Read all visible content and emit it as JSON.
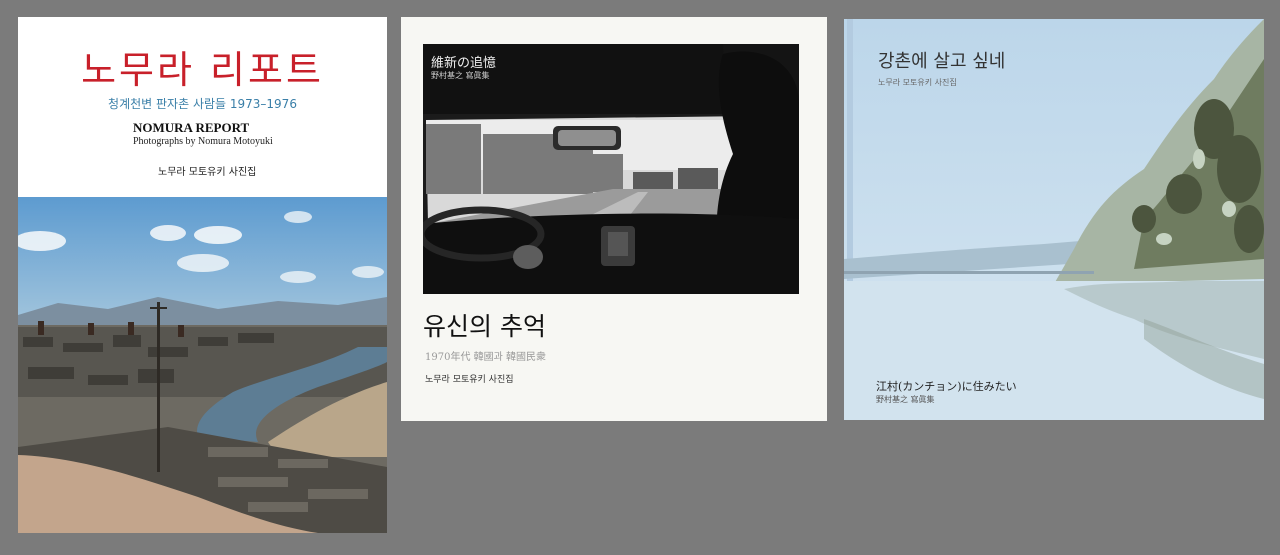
{
  "books": [
    {
      "title_ko": "노무라 리포트",
      "subtitle_ko": "청계천변 판자촌 사람들 1973–1976",
      "title_en": "NOMURA REPORT",
      "credit_en": "Photographs by Nomura Motoyuki",
      "photobook_ko": "노무라 모토유키 사진집"
    },
    {
      "photo_title": "維新の追憶",
      "photo_credit": "野村基之 寫眞集",
      "title_ko": "유신의 추억",
      "subtitle": "1970年代 韓國과 韓國民衆",
      "photobook_ko": "노무라 모토유키 사진집"
    },
    {
      "title_ko": "강촌에 살고 싶네",
      "photobook_ko": "노무라 모토유키 사진집",
      "title_jp": "江村(カンチョン)に住みたい",
      "credit_jp": "野村基之 寫眞集"
    }
  ],
  "colors": {
    "background": "#7b7b7b",
    "book1_title": "#c8202a",
    "book1_subtitle": "#3a7fa8"
  }
}
